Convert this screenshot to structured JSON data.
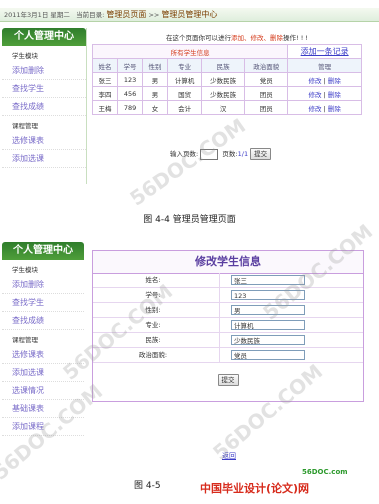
{
  "shot1": {
    "topbar": {
      "date": "2011年3月1日 星期二",
      "location_label": "当前目录:",
      "crumb1": "管理员页面",
      "sep": ">>",
      "crumb2": "管理员管理中心"
    },
    "sidebar": {
      "title": "个人管理中心",
      "section1": "学生模块",
      "items1": [
        "添加删除",
        "查找学生",
        "查找成绩"
      ],
      "section2": "课程管理",
      "items2": [
        "选修课表",
        "添加选课"
      ]
    },
    "notice": {
      "prefix": "在这个页面你可以进行",
      "ops": "添加、修改、删除",
      "suffix": "操作! ! !"
    },
    "table": {
      "caption": "所有学生信息",
      "add_link": "添加一条记录",
      "headers": [
        "姓名",
        "学号",
        "性别",
        "专业",
        "民族",
        "政治面貌",
        "管理"
      ],
      "rows": [
        [
          "张三",
          "123",
          "男",
          "计算机",
          "少数民族",
          "党员"
        ],
        [
          "李四",
          "456",
          "男",
          "国贸",
          "少数民族",
          "团员"
        ],
        [
          "王梅",
          "789",
          "女",
          "会计",
          "汉",
          "团员"
        ]
      ],
      "edit_label": "修改",
      "sep": "|",
      "delete_label": "删除"
    },
    "pager": {
      "input_label": "输入页数:",
      "page_label": "页数:",
      "page_value": "1/1",
      "submit": "提交"
    },
    "caption": "图 4-4 管理员管理页面"
  },
  "shot2": {
    "sidebar": {
      "title": "个人管理中心",
      "section1": "学生模块",
      "items1": [
        "添加删除",
        "查找学生",
        "查找成绩"
      ],
      "section2": "课程管理",
      "items2": [
        "选修课表",
        "添加选课",
        "选课情况",
        "基础课表",
        "添加课程"
      ]
    },
    "form": {
      "title": "修改学生信息",
      "fields": [
        {
          "label": "姓名:",
          "value": "张三"
        },
        {
          "label": "学号:",
          "value": "123"
        },
        {
          "label": "性别:",
          "value": "男"
        },
        {
          "label": "专业:",
          "value": "计算机"
        },
        {
          "label": "民族:",
          "value": "少数民族"
        },
        {
          "label": "政治面貌:",
          "value": "党员"
        }
      ],
      "submit": "提交"
    },
    "back_link": "返回",
    "caption": "图 4-5"
  },
  "watermarks": {
    "text": "56DOC.COM",
    "site": "56DOC.com",
    "brand": "中国毕业设计(论文)网"
  }
}
